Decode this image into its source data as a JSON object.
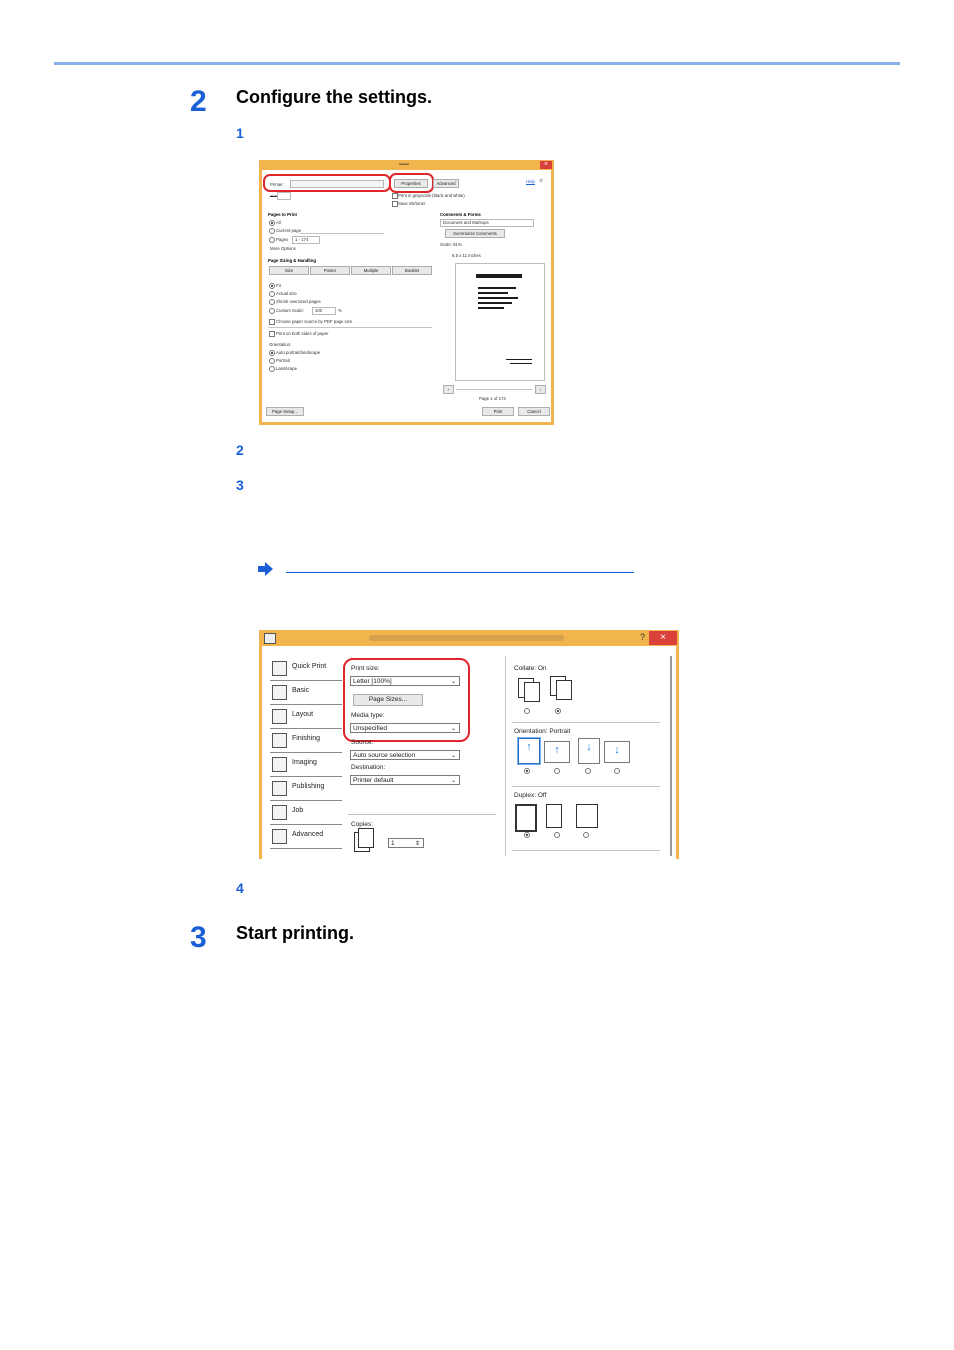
{
  "step2": {
    "number": "2",
    "heading": "Configure the settings."
  },
  "substeps": {
    "s1": "1",
    "s2": "2",
    "s3": "3",
    "s4": "4"
  },
  "step3": {
    "number": "3",
    "heading": "Start printing."
  },
  "shot1": {
    "printer_label": "Printer:",
    "properties_button": "Properties",
    "advanced_button": "Advanced",
    "help_link": "Help",
    "print_grayscale": "Print in grayscale (black and white)",
    "save_ink": "Save ink/toner",
    "pages_to_print": "Pages to Print",
    "all": "All",
    "current_page": "Current page",
    "pages": "Pages",
    "pages_value": "1 - 174",
    "more_options": "More Options",
    "page_sizing": "Page Sizing & Handling",
    "size_tab": "Size",
    "poster_tab": "Poster",
    "multiple_tab": "Multiple",
    "booklet_tab": "Booklet",
    "fit": "Fit",
    "actual_size": "Actual size",
    "shrink": "Shrink oversized pages",
    "custom_scale": "Custom Scale:",
    "custom_value": "100",
    "percent": "%",
    "choose_paper": "Choose paper source by PDF page size",
    "both_sides": "Print on both sides of paper",
    "orientation": "Orientation:",
    "auto": "Auto portrait/landscape",
    "portrait": "Portrait",
    "landscape": "Landscape",
    "comments_forms": "Comments & Forms",
    "comments_value": "Document and Markups",
    "summarize": "Summarize Comments",
    "scale": "Scale: 91%",
    "paper_size": "8.5 x 11 Inches",
    "page_of": "Page 1 of 174",
    "page_setup": "Page Setup...",
    "print_button": "Print",
    "cancel_button": "Cancel"
  },
  "shot2": {
    "help": "?",
    "close": "×",
    "sidebar": [
      "Quick Print",
      "Basic",
      "Layout",
      "Finishing",
      "Imaging",
      "Publishing",
      "Job",
      "Advanced"
    ],
    "print_size_label": "Print size:",
    "print_size_value": "Letter  [100%]",
    "page_sizes_button": "Page Sizes...",
    "media_type_label": "Media type:",
    "media_type_value": "Unspecified",
    "source_label": "Source:",
    "source_value": "Auto source selection",
    "destination_label": "Destination:",
    "destination_value": "Printer default",
    "copies_label": "Copies:",
    "copies_value": "1",
    "collate_label": "Collate:  On",
    "orientation_label": "Orientation:  Portrait",
    "duplex_label": "Duplex:  Off"
  }
}
